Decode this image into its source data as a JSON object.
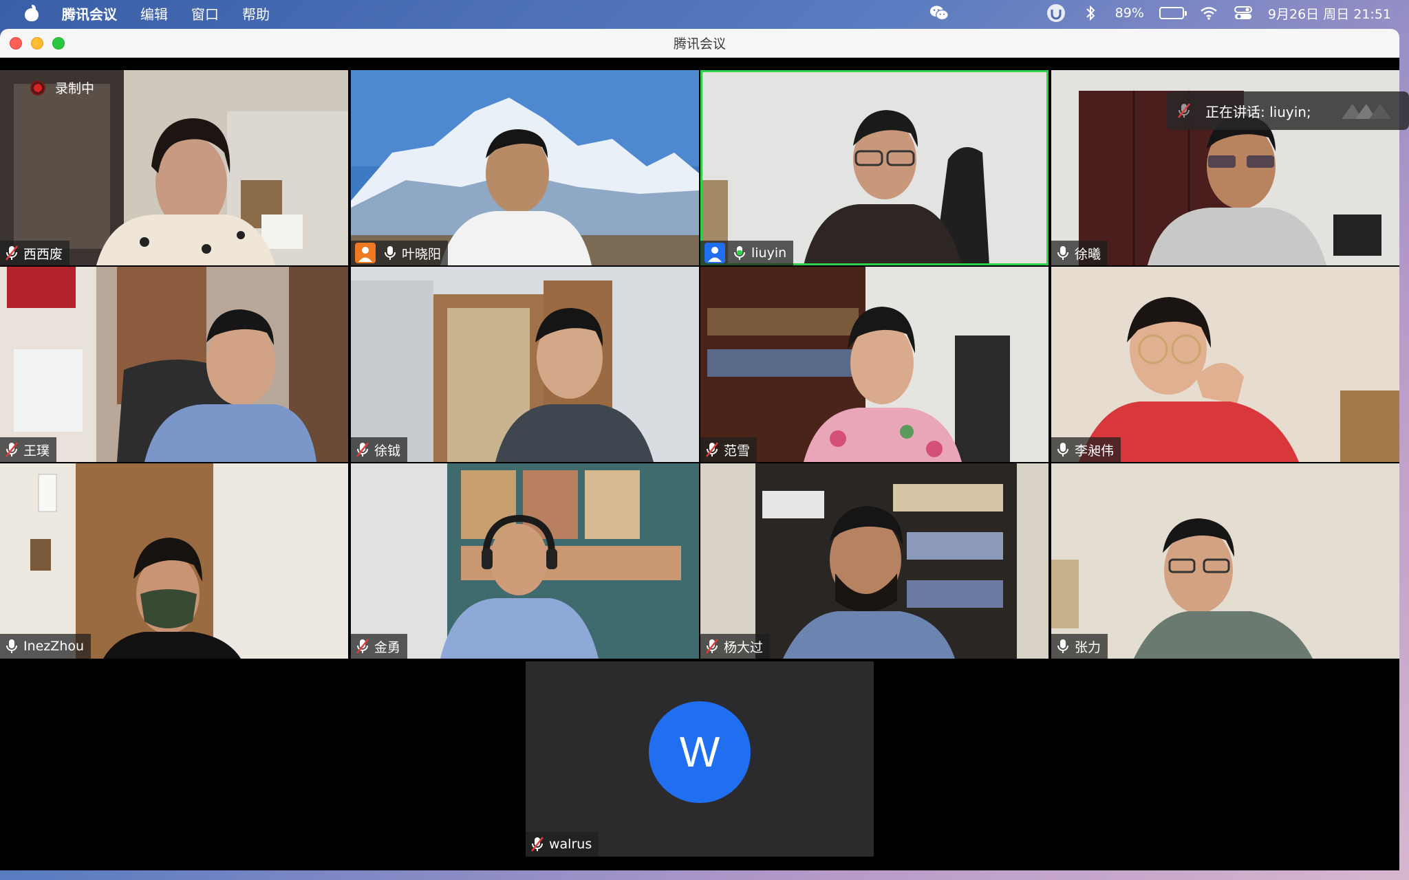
{
  "menubar": {
    "app_name": "腾讯会议",
    "menus": [
      "编辑",
      "窗口",
      "帮助"
    ],
    "battery_percent": "89%",
    "battery_level": 0.89,
    "datetime": "9月26日 周日  21:51"
  },
  "window": {
    "title": "腾讯会议"
  },
  "recording_label": "录制中",
  "speaking_banner": "正在讲话: liuyin;",
  "participants": [
    {
      "name": "西西废",
      "mic": "muted"
    },
    {
      "name": "叶晓阳",
      "mic": "on",
      "avatar_badge": "orange"
    },
    {
      "name": "liuyin",
      "mic": "speaking",
      "avatar_badge": "blue",
      "active": true
    },
    {
      "name": "徐曦",
      "mic": "on"
    },
    {
      "name": "王璞",
      "mic": "muted"
    },
    {
      "name": "徐钺",
      "mic": "muted"
    },
    {
      "name": "范雪",
      "mic": "muted"
    },
    {
      "name": "李昶伟",
      "mic": "on"
    },
    {
      "name": "InezZhou",
      "mic": "on"
    },
    {
      "name": "金勇",
      "mic": "muted"
    },
    {
      "name": "杨大过",
      "mic": "muted"
    },
    {
      "name": "张力",
      "mic": "on"
    }
  ],
  "walrus": {
    "name": "walrus",
    "initial": "W",
    "mic": "muted"
  },
  "colors": {
    "active_border": "#2fd04a",
    "avatar_blue": "#1f6ff0",
    "recording_red": "#d52424"
  }
}
